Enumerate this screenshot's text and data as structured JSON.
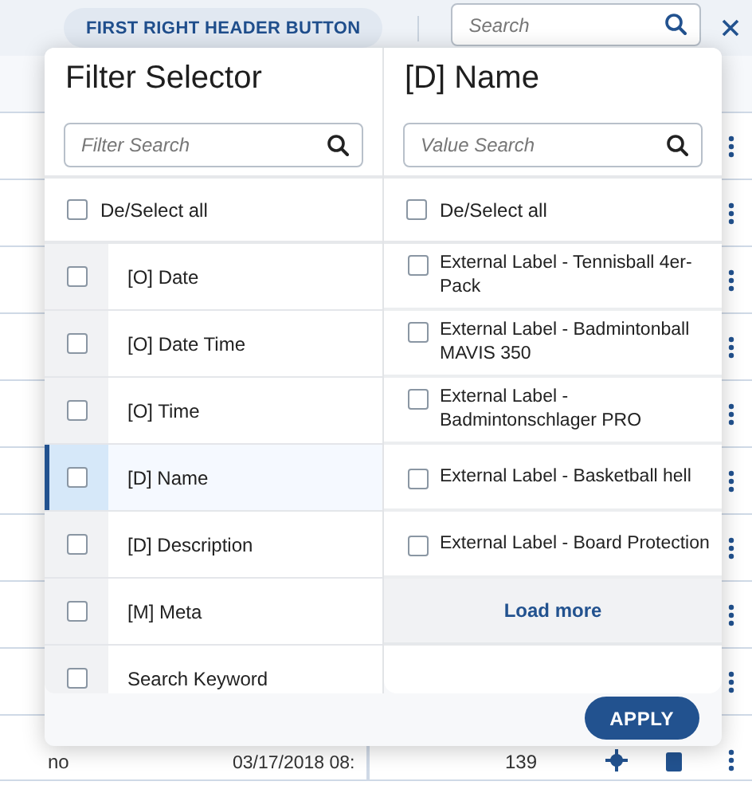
{
  "header": {
    "button": "FIRST RIGHT HEADER BUTTON",
    "search": {
      "placeholder": "Search"
    }
  },
  "table": {
    "last_row": {
      "column_1": "no",
      "column_2": "03/17/2018 08:",
      "column_3": "139"
    }
  },
  "filter_panel": {
    "title": "Filter Selector",
    "search": {
      "placeholder": "Filter Search"
    },
    "select_all": {
      "label": "De/Select all",
      "checked": false
    },
    "items": [
      {
        "label": "[O] Date",
        "checked": false,
        "selected": false
      },
      {
        "label": "[O] Date Time",
        "checked": false,
        "selected": false
      },
      {
        "label": "[O] Time",
        "checked": false,
        "selected": false
      },
      {
        "label": "[D] Name",
        "checked": false,
        "selected": true
      },
      {
        "label": "[D] Description",
        "checked": false,
        "selected": false
      },
      {
        "label": "[M] Meta",
        "checked": false,
        "selected": false
      },
      {
        "label": "Search Keyword",
        "checked": false,
        "selected": false
      }
    ]
  },
  "value_panel": {
    "title": "[D] Name",
    "search": {
      "placeholder": "Value Search"
    },
    "select_all": {
      "label": "De/Select all",
      "checked": false
    },
    "items": [
      {
        "label": "External Label - Tennisball 4er-Pack",
        "checked": false
      },
      {
        "label": "External Label - Badmintonball MAVIS 350",
        "checked": false
      },
      {
        "label": "External Label - Badmintonschlager PRO",
        "checked": false
      },
      {
        "label": "External Label - Basketball hell",
        "checked": false
      },
      {
        "label": "External Label - Board Protection",
        "checked": false
      }
    ],
    "load_more": "Load more"
  },
  "apply_button": "APPLY"
}
